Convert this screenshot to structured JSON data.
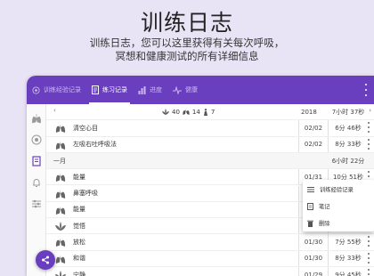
{
  "hero": {
    "title": "训练日志",
    "subtitle_line1": "训练日志，您可以这里获得有关每次呼吸，",
    "subtitle_line2": "冥想和健康测试的所有详细信息"
  },
  "tabs": [
    {
      "label": "训练经验记录",
      "icon": "target-icon",
      "active": false
    },
    {
      "label": "练习记录",
      "icon": "notebook-icon",
      "active": true
    },
    {
      "label": "进度",
      "icon": "bar-chart-icon",
      "active": false
    },
    {
      "label": "健康",
      "icon": "pulse-icon",
      "active": false
    }
  ],
  "summary": {
    "lotus_count": "40",
    "lungs_count": "14",
    "figure_count": "7",
    "year": "2018",
    "total": "7小时 37秒"
  },
  "rows": [
    {
      "type": "entry",
      "icon": "lungs-icon",
      "name": "清空心目",
      "date": "02/02",
      "duration": "6分 46秒"
    },
    {
      "type": "entry",
      "icon": "lungs-icon",
      "name": "左吸右吐呼吸法",
      "date": "02/02",
      "duration": "8分 33秒"
    },
    {
      "type": "month",
      "label": "一月",
      "duration": "6小时 22分"
    },
    {
      "type": "entry",
      "icon": "lungs-icon",
      "name": "能量",
      "date": "01/31",
      "duration": "10分 51秒"
    },
    {
      "type": "entry",
      "icon": "lungs-icon",
      "name": "鼻塞呼吸",
      "date": "01/31",
      "duration": ""
    },
    {
      "type": "entry",
      "icon": "lungs-icon",
      "name": "能量",
      "date": "01/31",
      "duration": ""
    },
    {
      "type": "entry",
      "icon": "lotus-icon",
      "name": "觉悟",
      "date": "01/30",
      "duration": ""
    },
    {
      "type": "entry",
      "icon": "lungs-icon",
      "name": "放松",
      "date": "01/30",
      "duration": "7分 55秒"
    },
    {
      "type": "entry",
      "icon": "lungs-icon",
      "name": "和谐",
      "date": "01/30",
      "duration": "8分 33秒"
    },
    {
      "type": "entry",
      "icon": "lotus-icon",
      "name": "宁静",
      "date": "01/29",
      "duration": "9分 45秒"
    }
  ],
  "context_menu": [
    {
      "label": "训练经验记录",
      "icon": "list-icon"
    },
    {
      "label": "笔记",
      "icon": "note-icon"
    },
    {
      "label": "删除",
      "icon": "trash-icon"
    }
  ],
  "fab_icon": "share-icon"
}
